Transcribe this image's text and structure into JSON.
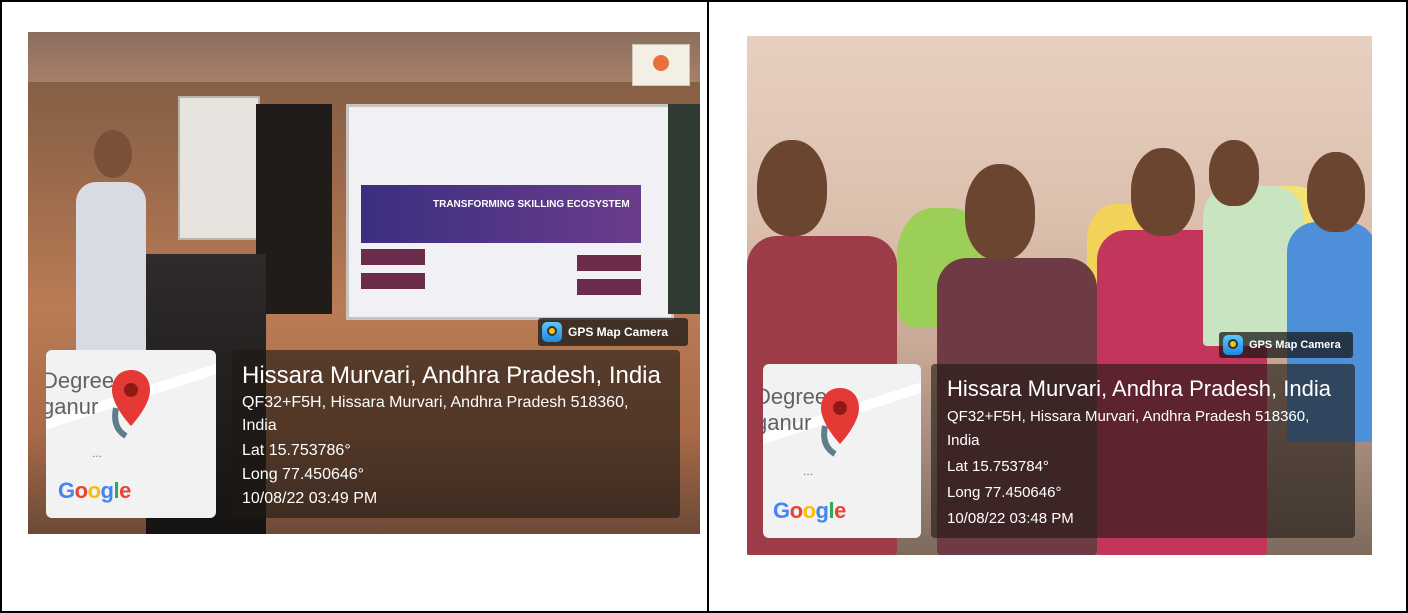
{
  "photos": [
    {
      "gps_label": "GPS Map Camera",
      "location_title": "Hissara Murvari, Andhra Pradesh, India",
      "address_line1": "QF32+F5H, Hissara Murvari, Andhra Pradesh 518360,",
      "address_line2": "India",
      "lat": "Lat 15.753786°",
      "long": "Long 77.450646°",
      "datetime": "10/08/22 03:49 PM",
      "map_place_line1": "Degree",
      "map_place_line2": "ganur",
      "map_dots": "...",
      "map_logo": "Google",
      "screen_text": "TRANSFORMING SKILLING ECOSYSTEM"
    },
    {
      "gps_label": "GPS Map Camera",
      "location_title": "Hissara Murvari, Andhra Pradesh, India",
      "address_line1": "QF32+F5H, Hissara Murvari, Andhra Pradesh 518360,",
      "address_line2": "India",
      "lat": "Lat 15.753784°",
      "long": "Long 77.450646°",
      "datetime": "10/08/22 03:48 PM",
      "map_place_line1": "Degree",
      "map_place_line2": "ganur",
      "map_dots": "...",
      "map_logo": "Google"
    }
  ]
}
